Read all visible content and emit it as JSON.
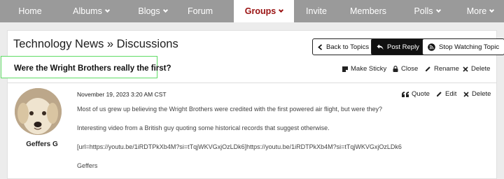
{
  "nav": {
    "items": [
      {
        "label": "Home",
        "dropdown": false
      },
      {
        "label": "Albums",
        "dropdown": true
      },
      {
        "label": "Blogs",
        "dropdown": true
      },
      {
        "label": "Forum",
        "dropdown": false
      },
      {
        "label": "Groups",
        "dropdown": true,
        "active": true
      },
      {
        "label": "Invite",
        "dropdown": false
      },
      {
        "label": "Members",
        "dropdown": false
      },
      {
        "label": "Polls",
        "dropdown": true
      },
      {
        "label": "More",
        "dropdown": true
      }
    ]
  },
  "header": {
    "title": "Technology News » Discussions",
    "back_label": "Back to Topics",
    "post_reply_label": "Post Reply",
    "stop_watching_label": "Stop Watching Topic"
  },
  "topic": {
    "title": "Were the Wright Brothers really the first?",
    "actions": {
      "make_sticky": "Make Sticky",
      "close": "Close",
      "rename": "Rename",
      "delete": "Delete"
    }
  },
  "post": {
    "author": "Geffers G",
    "date": "November 19, 2023 3:20 AM CST",
    "actions": {
      "quote": "Quote",
      "edit": "Edit",
      "delete": "Delete"
    },
    "lines": [
      "Most of us grew up believing the Wright Brothers were credited with the first powered air flight, but were they?",
      "Interesting video from a British guy quoting some historical records that suggest otherwise.",
      "[url=https://youtu.be/1iRDTPkXb4M?si=tTqjWKVGxjOzLDk6]https://youtu.be/1iRDTPkXb4M?si=tTqjWKVGxjOzLDk6",
      "Geffers"
    ]
  },
  "colors": {
    "nav_bg": "#9a9a9a",
    "nav_active_text": "#9a1212",
    "highlight_border": "#5fdc65"
  }
}
